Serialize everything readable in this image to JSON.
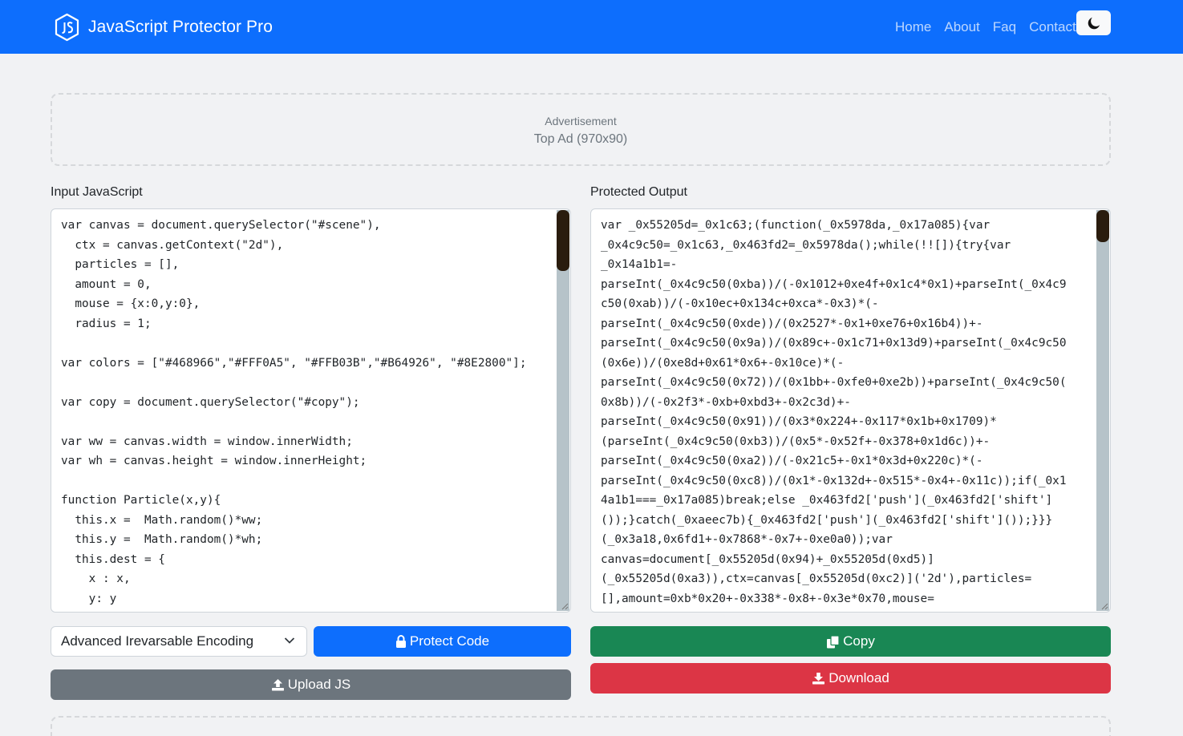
{
  "navbar": {
    "brand": "JavaScript Protector Pro",
    "brand_icon": "js-shield-icon",
    "links": [
      "Home",
      "About",
      "Faq",
      "Contact"
    ],
    "theme_icon": "moon-icon"
  },
  "ad_top": {
    "label": "Advertisement",
    "size": "Top Ad (970x90)"
  },
  "input": {
    "label": "Input JavaScript",
    "code": "var canvas = document.querySelector(\"#scene\"),\n  ctx = canvas.getContext(\"2d\"),\n  particles = [],\n  amount = 0,\n  mouse = {x:0,y:0},\n  radius = 1;\n\nvar colors = [\"#468966\",\"#FFF0A5\", \"#FFB03B\",\"#B64926\", \"#8E2800\"];\n\nvar copy = document.querySelector(\"#copy\");\n\nvar ww = canvas.width = window.innerWidth;\nvar wh = canvas.height = window.innerHeight;\n\nfunction Particle(x,y){\n  this.x =  Math.random()*ww;\n  this.y =  Math.random()*wh;\n  this.dest = {\n    x : x,\n    y: y\n  };"
  },
  "output": {
    "label": "Protected Output",
    "code": "var _0x55205d=_0x1c63;(function(_0x5978da,_0x17a085){var\n_0x4c9c50=_0x1c63,_0x463fd2=_0x5978da();while(!![]){try{var\n_0x14a1b1=-\nparseInt(_0x4c9c50(0xba))/(-0x1012+0xe4f+0x1c4*0x1)+parseInt(_0x4c9\nc50(0xab))/(-0x10ec+0x134c+0xca*-0x3)*(-\nparseInt(_0x4c9c50(0xde))/(0x2527*-0x1+0xe76+0x16b4))+-\nparseInt(_0x4c9c50(0x9a))/(0x89c+-0x1c71+0x13d9)+parseInt(_0x4c9c50\n(0x6e))/(0xe8d+0x61*0x6+-0x10ce)*(-\nparseInt(_0x4c9c50(0x72))/(0x1bb+-0xfe0+0xe2b))+parseInt(_0x4c9c50(\n0x8b))/(-0x2f3*-0xb+0xbd3+-0x2c3d)+-\nparseInt(_0x4c9c50(0x91))/(0x3*0x224+-0x117*0x1b+0x1709)*\n(parseInt(_0x4c9c50(0xb3))/(0x5*-0x52f+-0x378+0x1d6c))+-\nparseInt(_0x4c9c50(0xa2))/(-0x21c5+-0x1*0x3d+0x220c)*(-\nparseInt(_0x4c9c50(0xc8))/(0x1*-0x132d+-0x515*-0x4+-0x11c));if(_0x1\n4a1b1===_0x17a085)break;else _0x463fd2['push'](_0x463fd2['shift']\n());}catch(_0xaeec7b){_0x463fd2['push'](_0x463fd2['shift']());}}}\n(_0x3a18,0x6fd1+-0x7868*-0x7+-0xe0a0));var\ncanvas=document[_0x55205d(0x94)+_0x55205d(0xd5)]\n(_0x55205d(0xa3)),ctx=canvas[_0x55205d(0xc2)]('2d'),particles=\n[],amount=0xb*0x20+-0x338*-0x8+-0x3e*0x70,mouse="
  },
  "controls": {
    "encoding_selected": "Advanced Irevarsable Encoding",
    "protect_label": "Protect Code",
    "protect_icon": "lock-icon",
    "upload_label": "Upload JS",
    "upload_icon": "upload-icon",
    "copy_label": "Copy",
    "copy_icon": "copy-icon",
    "download_label": "Download",
    "download_icon": "download-icon"
  },
  "colors": {
    "primary": "#0d6efd",
    "secondary": "#6c757d",
    "success": "#198754",
    "danger": "#dc3545",
    "page_bg": "#f1f2f4"
  }
}
